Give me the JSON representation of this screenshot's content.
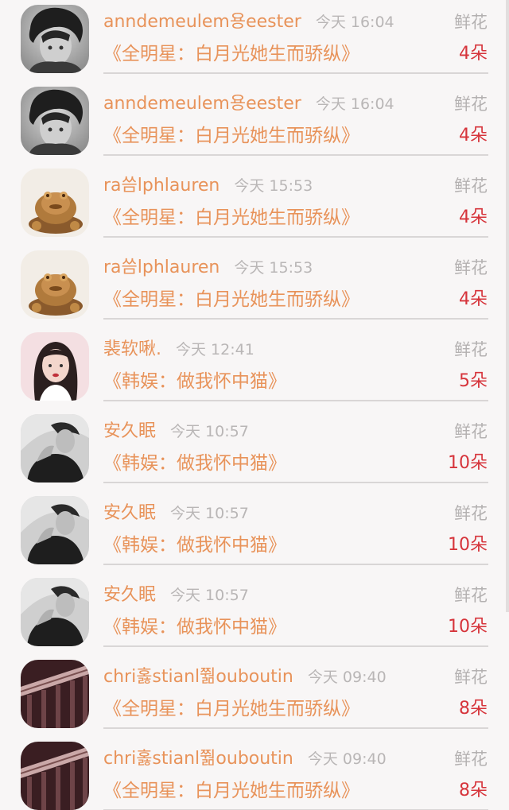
{
  "gift_records": [
    {
      "user": "anndemeulem용eester",
      "time": "今天 16:04",
      "gift_type": "鲜花",
      "book": "《全明星：白月光她生而骄纵》",
      "amount": "4朵",
      "avatar": "avatar-boy-icon"
    },
    {
      "user": "anndemeulem용eester",
      "time": "今天 16:04",
      "gift_type": "鲜花",
      "book": "《全明星：白月光她生而骄纵》",
      "amount": "4朵",
      "avatar": "avatar-boy-icon"
    },
    {
      "user": "ra씀lphlauren",
      "time": "今天 15:53",
      "gift_type": "鲜花",
      "book": "《全明星：白月光她生而骄纵》",
      "amount": "4朵",
      "avatar": "avatar-golden-toad-icon"
    },
    {
      "user": "ra씀lphlauren",
      "time": "今天 15:53",
      "gift_type": "鲜花",
      "book": "《全明星：白月光她生而骄纵》",
      "amount": "4朵",
      "avatar": "avatar-golden-toad-icon"
    },
    {
      "user": "裴软啾.",
      "time": "今天 12:41",
      "gift_type": "鲜花",
      "book": "《韩娱：做我怀中猫》",
      "amount": "5朵",
      "avatar": "avatar-girl-icon"
    },
    {
      "user": "安久眠",
      "time": "今天 10:57",
      "gift_type": "鲜花",
      "book": "《韩娱：做我怀中猫》",
      "amount": "10朵",
      "avatar": "avatar-man-icon"
    },
    {
      "user": "安久眠",
      "time": "今天 10:57",
      "gift_type": "鲜花",
      "book": "《韩娱：做我怀中猫》",
      "amount": "10朵",
      "avatar": "avatar-man-icon"
    },
    {
      "user": "安久眠",
      "time": "今天 10:57",
      "gift_type": "鲜花",
      "book": "《韩娱：做我怀中猫》",
      "amount": "10朵",
      "avatar": "avatar-man-icon"
    },
    {
      "user": "chri홇stianl쭮ouboutin",
      "time": "今天 09:40",
      "gift_type": "鲜花",
      "book": "《全明星：白月光她生而骄纵》",
      "amount": "8朵",
      "avatar": "avatar-railing-icon"
    },
    {
      "user": "chri홇stianl쭮ouboutin",
      "time": "今天 09:40",
      "gift_type": "鲜花",
      "book": "《全明星：白月光她生而骄纵》",
      "amount": "8朵",
      "avatar": "avatar-railing-icon"
    }
  ],
  "colors": {
    "name_text": "#e8935a",
    "amount_text": "#d6343b",
    "muted_text": "#b4b1b1",
    "background": "#f8f6f6"
  }
}
